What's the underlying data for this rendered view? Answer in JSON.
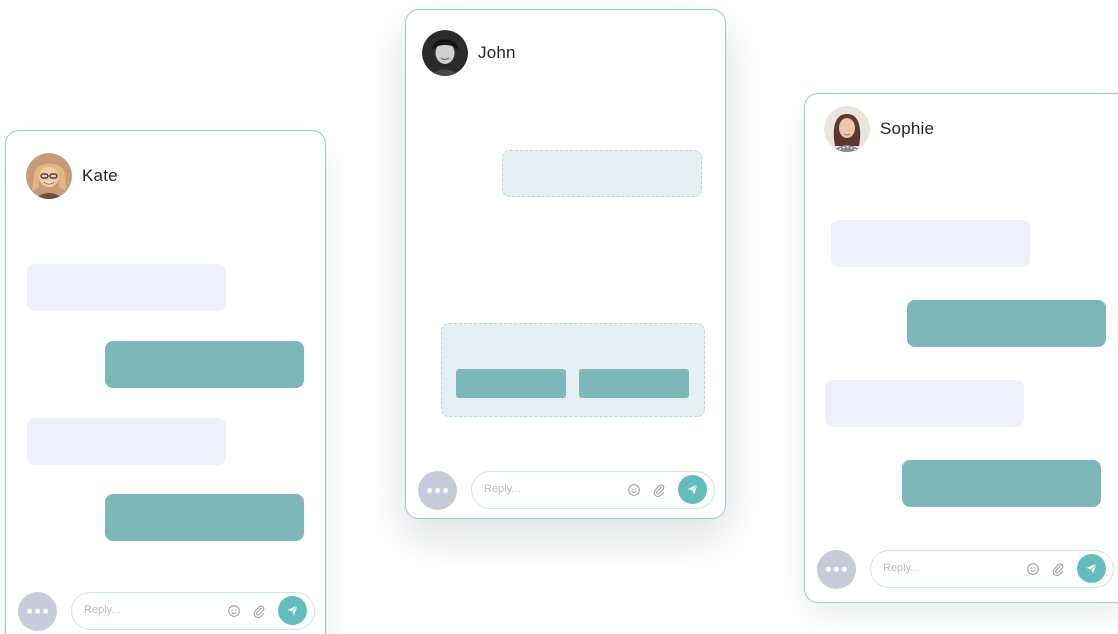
{
  "chats": {
    "kate": {
      "name": "Kate",
      "reply_placeholder": "Reply..."
    },
    "john": {
      "name": "John",
      "reply_placeholder": "Reply..."
    },
    "sophie": {
      "name": "Sophie",
      "reply_placeholder": "Reply..."
    }
  },
  "colors": {
    "card_border": "#9ccbcd",
    "bubble_incoming": "#eff0f9",
    "bubble_outgoing": "#7eb7ba",
    "ghost_bubble": "#e4f0f1",
    "more_button": "#c8cbd8",
    "send_button": "#63bdbd"
  },
  "icons": [
    "more-icon",
    "emoji-icon",
    "attachment-icon",
    "send-icon",
    "avatar"
  ]
}
